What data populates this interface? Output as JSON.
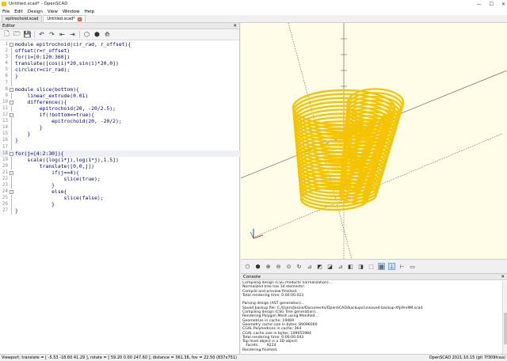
{
  "window": {
    "title": "Untitled.scad* - OpenSCAD",
    "controls": [
      "—",
      "☐",
      "✕"
    ]
  },
  "menu": [
    "File",
    "Edit",
    "Design",
    "View",
    "Window",
    "Help"
  ],
  "tabs": [
    {
      "label": "epitrochoid.scad",
      "active": false
    },
    {
      "label": "Untitled.scad*",
      "active": true
    }
  ],
  "editor": {
    "header": "Editor",
    "close": "✕",
    "lines": [
      {
        "n": "1",
        "fold": "-",
        "text": "module epitrochoid(cir_rad, r_offset){"
      },
      {
        "n": "2",
        "fold": "",
        "text": "offset(r=r_offset)"
      },
      {
        "n": "3",
        "fold": "",
        "text": "for(i=[0:120:360])"
      },
      {
        "n": "4",
        "fold": "",
        "text": "translate([cos(i)*20,sin(i)*20,0])"
      },
      {
        "n": "5",
        "fold": "",
        "text": "circle(r=cir_rad);"
      },
      {
        "n": "6",
        "fold": "",
        "text": "}"
      },
      {
        "n": "7",
        "fold": "",
        "text": ""
      },
      {
        "n": "8",
        "fold": "-",
        "text": "module slice(bottom){"
      },
      {
        "n": "9",
        "fold": "",
        "text": "    linear_extrude(0.01)"
      },
      {
        "n": "10",
        "fold": "-",
        "text": "    difference(){"
      },
      {
        "n": "11",
        "fold": "",
        "text": "        epitrochoid(20, -20/2.5);"
      },
      {
        "n": "12",
        "fold": "-",
        "text": "        if(!bottom==true){"
      },
      {
        "n": "13",
        "fold": "",
        "text": "            epitrochoid(20, -20/2);"
      },
      {
        "n": "14",
        "fold": "",
        "text": "        }"
      },
      {
        "n": "15",
        "fold": "",
        "text": "    }"
      },
      {
        "n": "16",
        "fold": "",
        "text": "}"
      },
      {
        "n": "17",
        "fold": "",
        "text": ""
      },
      {
        "n": "18",
        "fold": "-",
        "text": "for(j=[4:2:30]){"
      },
      {
        "n": "19",
        "fold": "",
        "text": "    scale([log(1*j),log(1*j),1.5])"
      },
      {
        "n": "20",
        "fold": "",
        "text": "        translate([0,0,j])"
      },
      {
        "n": "21",
        "fold": "-",
        "text": "            if(j==4){"
      },
      {
        "n": "22",
        "fold": "",
        "text": "                slice(true);"
      },
      {
        "n": "23",
        "fold": "",
        "text": "            }"
      },
      {
        "n": "24",
        "fold": "-",
        "text": "            else{"
      },
      {
        "n": "25",
        "fold": "",
        "text": "                slice(false);"
      },
      {
        "n": "26",
        "fold": "",
        "text": "            }"
      },
      {
        "n": "27",
        "fold": "",
        "text": "}"
      }
    ]
  },
  "console": {
    "header": "Console",
    "close": "✕",
    "lines": [
      "Compiling design (CSG Products normalization)...",
      "Normalized tree has 14 elements!",
      "Compile and preview finished.",
      "Total rendering time: 0:00:00.023",
      "",
      "Parsing design (AST generation)...",
      "Saved backup file: C:/Users/Jessie/Documents/OpenSCAD/backups/unsaved-backup-Xfp9rv9M.scad",
      "Compiling design (CSG Tree generation)...",
      "Rendering Polygon Mesh using Manifold...",
      "Geometries in cache: 19469",
      "Geometry cache size in bytes: 89096000",
      "CGAL Polyhedrons in cache: 364",
      "CGAL cache size in bytes: 109055984",
      "Total rendering time: 0:00:00.043",
      "Top level object is a 3D object:",
      "   Facets:       9224",
      "Rendering finished."
    ]
  },
  "statusbar": {
    "left": "Viewport: translate = [ -5.53 -18.60 41.29 ], rotate = [ 59.20 0.00 247.60 ], distance = 361.36, fov = 22.50 (837x751)",
    "right": "OpenSCAD 2021.10.15 (git 7f309fcea)"
  },
  "colors": {
    "model": "#f5c400",
    "viewport_bg": "#fffde8",
    "code": "#00007f"
  }
}
